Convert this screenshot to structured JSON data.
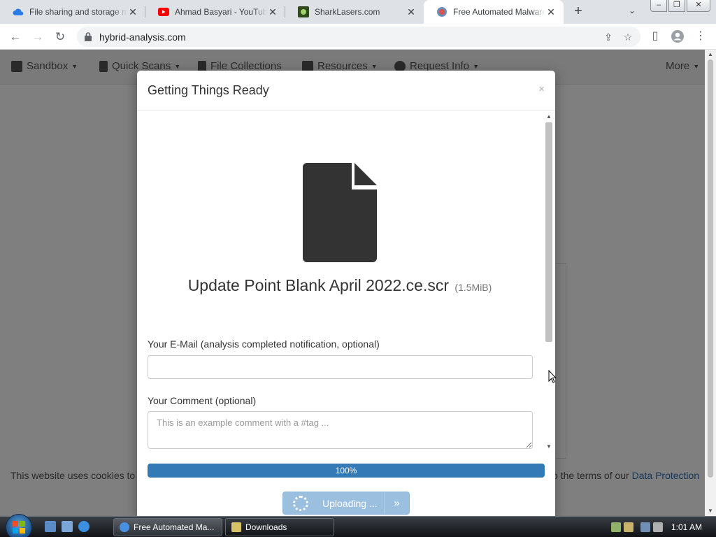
{
  "browser": {
    "tabs": [
      {
        "title": "File sharing and storage m",
        "icon": "cloud-icon"
      },
      {
        "title": "Ahmad Basyari - YouTube",
        "icon": "youtube-icon"
      },
      {
        "title": "SharkLasers.com",
        "icon": "sharklasers-icon"
      },
      {
        "title": "Free Automated Malware",
        "icon": "hybrid-analysis-icon"
      }
    ],
    "active_tab_index": 3,
    "url": "hybrid-analysis.com"
  },
  "site_nav": {
    "items": [
      {
        "label": "Sandbox",
        "icon": "cube-icon"
      },
      {
        "label": "Quick Scans",
        "icon": "file-plus-icon"
      },
      {
        "label": "File Collections",
        "icon": "files-icon"
      },
      {
        "label": "Resources",
        "icon": "folder-icon"
      },
      {
        "label": "Request Info",
        "icon": "question-icon"
      }
    ],
    "more_label": "More"
  },
  "cookie_banner": {
    "left_text": "This website uses cookies to",
    "right_text": "o the terms of our ",
    "link_text": "Data Protection"
  },
  "modal": {
    "title": "Getting Things Ready",
    "close_glyph": "×",
    "file_name": "Update Point Blank April 2022.ce.scr",
    "file_size": "(1.5MiB)",
    "email_label": "Your E-Mail (analysis completed notification, optional)",
    "email_value": "",
    "comment_label": "Your Comment (optional)",
    "comment_placeholder": "This is an example comment with a #tag ...",
    "progress_percent": 100,
    "progress_label": "100%",
    "upload_label": "Uploading ..."
  },
  "taskbar": {
    "tasks": [
      {
        "label": "Free Automated Ma...",
        "icon": "chrome-icon"
      },
      {
        "label": "Downloads",
        "icon": "folder-icon"
      }
    ],
    "clock": "1:01 AM"
  },
  "colors": {
    "progress": "#337ab7",
    "button_disabled": "#9bbfdf",
    "link": "#2b6cb0"
  }
}
